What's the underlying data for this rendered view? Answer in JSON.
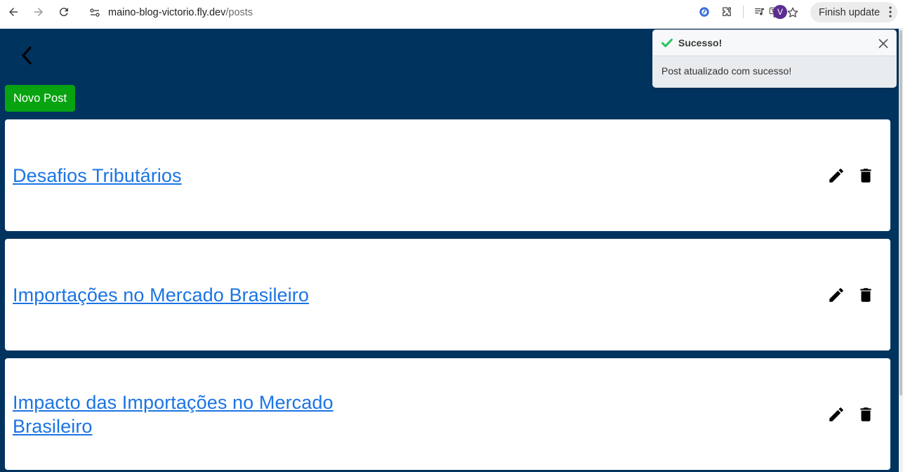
{
  "browser": {
    "url_host": "maino-blog-victorio.fly.dev",
    "url_path": "/posts",
    "profile_initial": "V",
    "update_button_label": "Finish update"
  },
  "page": {
    "new_post_label": "Novo Post",
    "posts": [
      {
        "title": "Desafios Tributários"
      },
      {
        "title": "Importações no Mercado Brasileiro"
      },
      {
        "title": "Impacto das Importações no Mercado Brasileiro"
      }
    ]
  },
  "toast": {
    "title": "Sucesso!",
    "message": "Post atualizado com sucesso!"
  },
  "colors": {
    "page_background": "#01335f",
    "new_post_button": "#07a310",
    "post_link": "#1b74e4",
    "success_check": "#22c55e"
  }
}
